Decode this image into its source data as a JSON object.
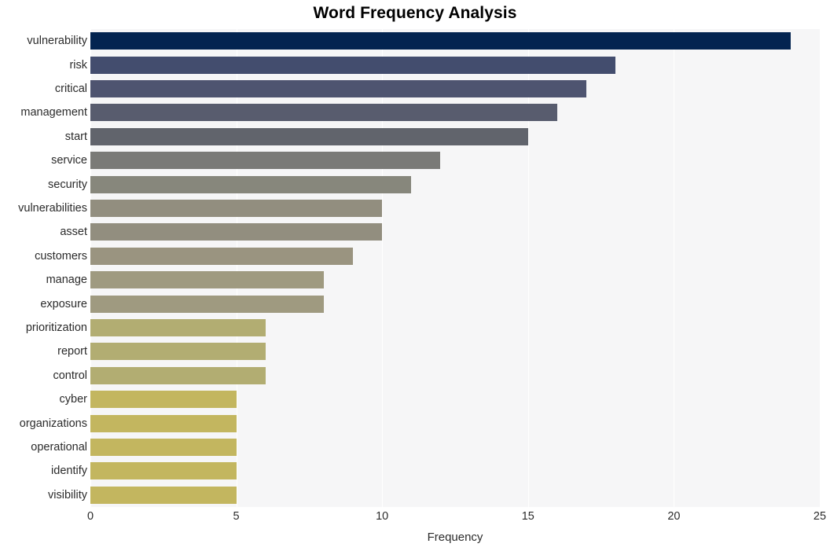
{
  "chart_data": {
    "type": "bar",
    "orientation": "horizontal",
    "title": "Word Frequency Analysis",
    "xlabel": "Frequency",
    "ylabel": "",
    "xlim": [
      0,
      25
    ],
    "xticks": [
      0,
      5,
      10,
      15,
      20,
      25
    ],
    "xticklabels": [
      "0",
      "5",
      "10",
      "15",
      "20",
      "25"
    ],
    "grid": true,
    "grid_axis": "x",
    "grid_color": "#ffffff",
    "plot_background": "#f6f6f7",
    "figure_background": "#ffffff",
    "legend": null,
    "categories": [
      "vulnerability",
      "risk",
      "critical",
      "management",
      "start",
      "service",
      "security",
      "vulnerabilities",
      "asset",
      "customers",
      "manage",
      "exposure",
      "prioritization",
      "report",
      "control",
      "cyber",
      "organizations",
      "operational",
      "identify",
      "visibility"
    ],
    "values": [
      24,
      18,
      17,
      16,
      15,
      12,
      11,
      10,
      10,
      9,
      8,
      8,
      6,
      6,
      6,
      5,
      5,
      5,
      5,
      5
    ],
    "bar_colors": [
      "#032450",
      "#434d6e",
      "#4e5470",
      "#585c6e",
      "#61646c",
      "#7a7a77",
      "#87877c",
      "#928e7f",
      "#928e7f",
      "#9a9480",
      "#9f9a80",
      "#9f9a80",
      "#b2ad72",
      "#b2ad72",
      "#b2ad72",
      "#c3b65f",
      "#c3b65f",
      "#c3b65f",
      "#c3b65f",
      "#c3b65f"
    ]
  }
}
